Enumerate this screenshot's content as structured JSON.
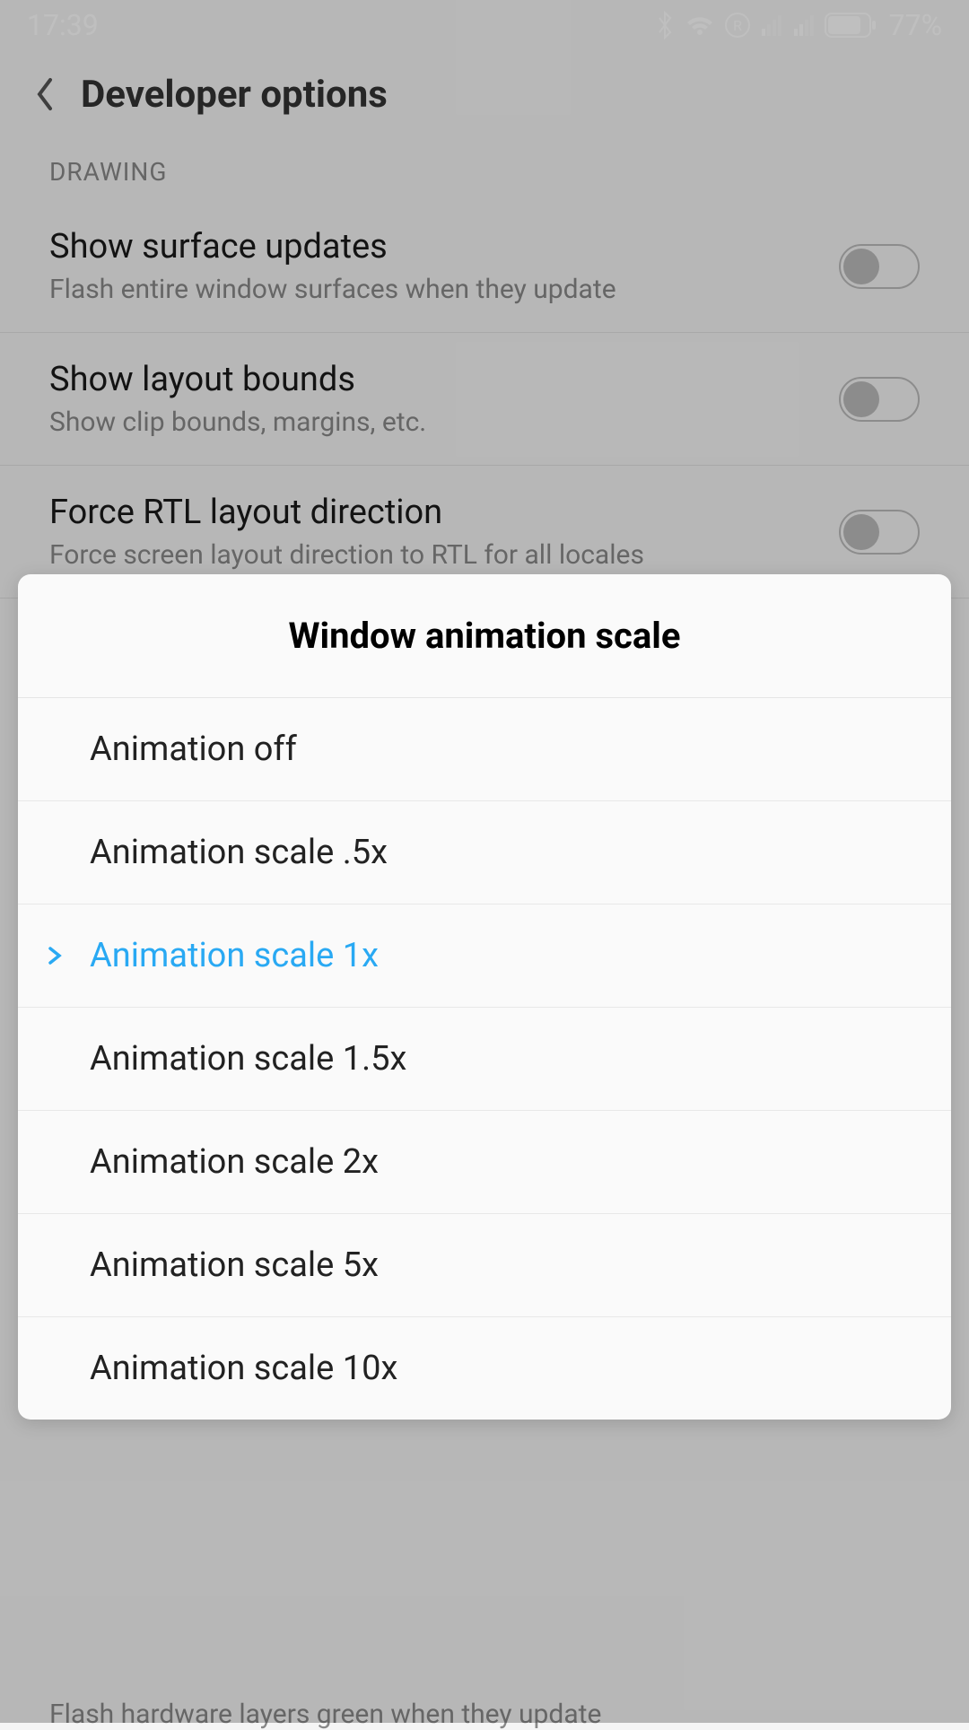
{
  "status": {
    "time": "17:39",
    "battery": "77%"
  },
  "header": {
    "title": "Developer options"
  },
  "section": {
    "label": "DRAWING"
  },
  "settings": [
    {
      "title": "Show surface updates",
      "sub": "Flash entire window surfaces when they update"
    },
    {
      "title": "Show layout bounds",
      "sub": "Show clip bounds, margins, etc."
    },
    {
      "title": "Force RTL layout direction",
      "sub": "Force screen layout direction to RTL for all locales"
    }
  ],
  "modal": {
    "title": "Window animation scale",
    "options": [
      "Animation off",
      "Animation scale .5x",
      "Animation scale 1x",
      "Animation scale 1.5x",
      "Animation scale 2x",
      "Animation scale 5x",
      "Animation scale 10x"
    ],
    "selected_index": 2
  },
  "ghost": "Flash hardware layers green when they update"
}
